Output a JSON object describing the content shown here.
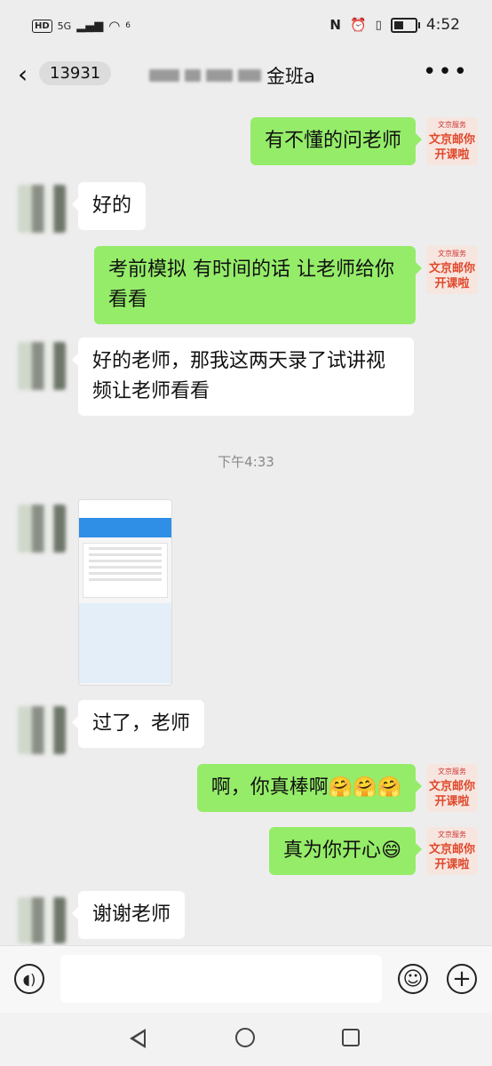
{
  "status_bar": {
    "hd": "HD",
    "network": "5G",
    "wifi_sub": "6",
    "time": "4:52"
  },
  "header": {
    "unread_count": "13931",
    "title_suffix": "金班a"
  },
  "messages": [
    {
      "side": "right",
      "text": "有不懂的问老师"
    },
    {
      "side": "left",
      "text": "好的"
    },
    {
      "side": "right",
      "text": "考前模拟 有时间的话 让老师给你看看"
    },
    {
      "side": "left",
      "text": "好的老师，那我这两天录了试讲视频让老师看看"
    },
    {
      "type": "time",
      "text": "下午4:33"
    },
    {
      "side": "left",
      "type": "image",
      "text": ""
    },
    {
      "side": "left",
      "text": "过了，老师"
    },
    {
      "side": "right",
      "text": "啊，你真棒啊",
      "emoji": "🤗🤗🤗"
    },
    {
      "side": "right",
      "text": "真为你开心",
      "emoji": "😄"
    },
    {
      "side": "left",
      "text": "谢谢老师"
    }
  ],
  "sticker": {
    "brand": "文京服务",
    "line1": "文京邮你",
    "line2": "开课啦"
  },
  "input_bar": {
    "voice_icon": "voice-icon",
    "emoji_icon": "smile-icon",
    "plus_icon": "plus-icon"
  },
  "colors": {
    "background": "#ededed",
    "self_bubble": "#95ec69",
    "other_bubble": "#ffffff"
  }
}
